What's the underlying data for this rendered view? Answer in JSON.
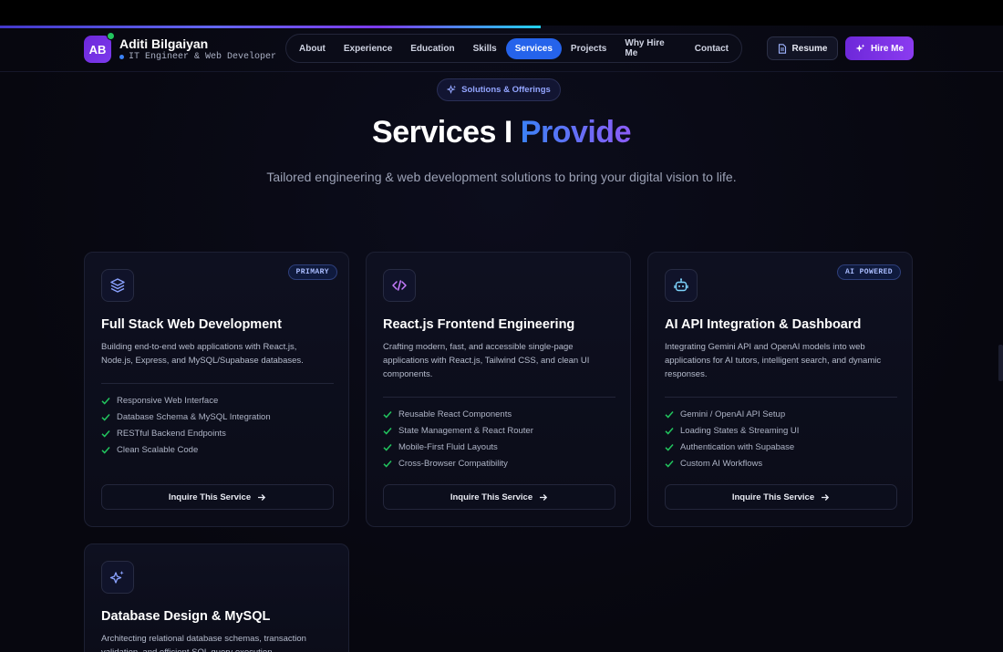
{
  "brand": {
    "initials": "AB",
    "name": "Aditi Bilgaiyan",
    "role": "IT Engineer & Web Developer"
  },
  "nav": {
    "items": [
      {
        "label": "About",
        "active": false
      },
      {
        "label": "Experience",
        "active": false
      },
      {
        "label": "Education",
        "active": false
      },
      {
        "label": "Skills",
        "active": false
      },
      {
        "label": "Services",
        "active": true
      },
      {
        "label": "Projects",
        "active": false
      },
      {
        "label": "Why Hire Me",
        "active": false
      },
      {
        "label": "Contact",
        "active": false
      }
    ],
    "resume_label": "Resume",
    "hire_label": "Hire Me"
  },
  "section": {
    "pill_label": "Solutions & Offerings",
    "title_main": "Services I ",
    "title_accent": "Provide",
    "subtitle": "Tailored engineering & web development solutions to bring your digital vision to life."
  },
  "cards": [
    {
      "icon": "layers-icon",
      "badge": "PRIMARY",
      "title": "Full Stack Web Development",
      "description": "Building end-to-end web applications with React.js, Node.js, Express, and MySQL/Supabase databases.",
      "features": [
        "Responsive Web Interface",
        "Database Schema & MySQL Integration",
        "RESTful Backend Endpoints",
        "Clean Scalable Code"
      ],
      "cta": "Inquire This Service"
    },
    {
      "icon": "code-icon",
      "badge": "",
      "title": "React.js Frontend Engineering",
      "description": "Crafting modern, fast, and accessible single-page applications with React.js, Tailwind CSS, and clean UI components.",
      "features": [
        "Reusable React Components",
        "State Management & React Router",
        "Mobile-First Fluid Layouts",
        "Cross-Browser Compatibility"
      ],
      "cta": "Inquire This Service"
    },
    {
      "icon": "robot-icon",
      "badge": "AI POWERED",
      "title": "AI API Integration & Dashboard",
      "description": "Integrating Gemini API and OpenAI models into web applications for AI tutors, intelligent search, and dynamic responses.",
      "features": [
        "Gemini / OpenAI API Setup",
        "Loading States & Streaming UI",
        "Authentication with Supabase",
        "Custom AI Workflows"
      ],
      "cta": "Inquire This Service"
    },
    {
      "icon": "sparkles-icon",
      "badge": "",
      "title": "Database Design & MySQL",
      "description": "Architecting relational database schemas, transaction validation, and efficient SQL query execution.",
      "features": [],
      "cta": ""
    }
  ],
  "colors": {
    "accent": "#2563eb",
    "violet": "#7c3aed",
    "check": "#22c55e",
    "background": "#07070f"
  }
}
